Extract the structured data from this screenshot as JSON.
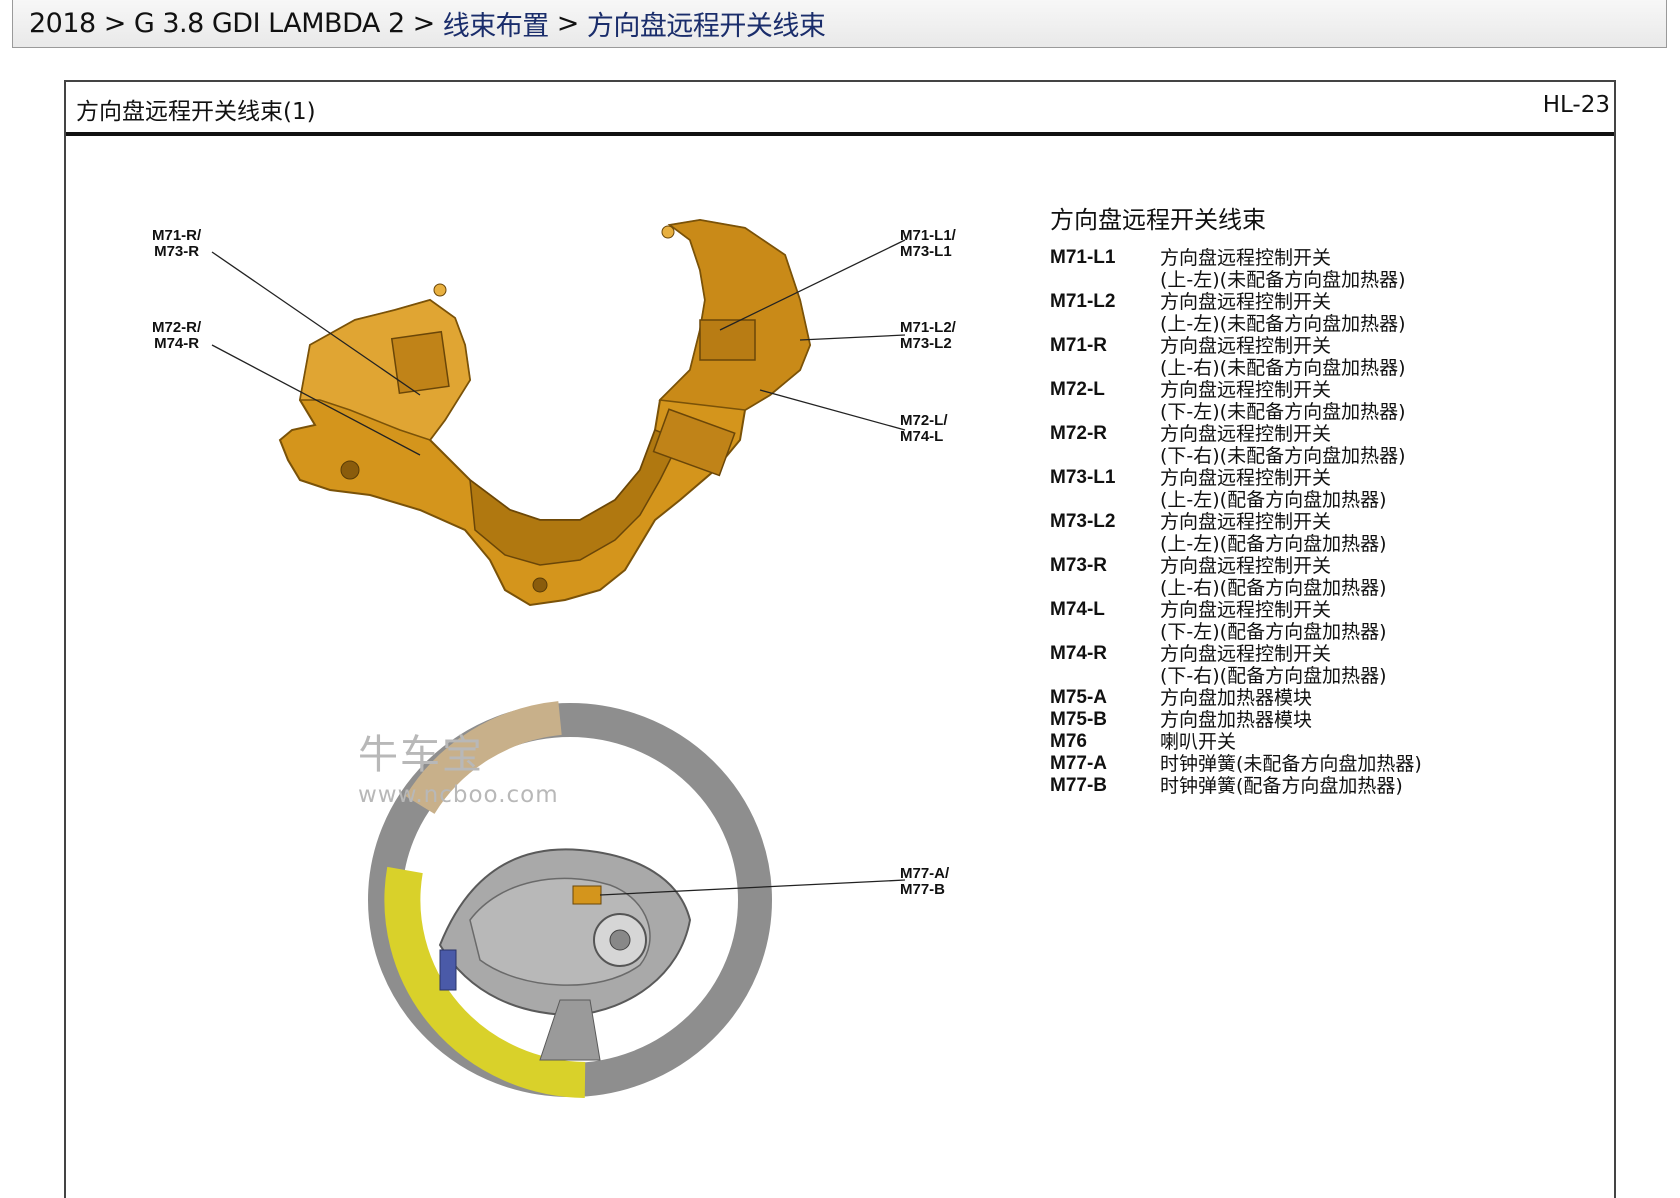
{
  "breadcrumb": {
    "items": [
      "2018",
      "G 3.8 GDI LAMBDA 2",
      "线束布置",
      "方向盘远程开关线束"
    ],
    "separator": ">"
  },
  "sheet": {
    "title": "方向盘远程开关线束(1)",
    "code": "HL-23"
  },
  "callouts": {
    "m71r_m73r": [
      "M71-R/",
      "M73-R"
    ],
    "m72r_m74r": [
      "M72-R/",
      "M74-R"
    ],
    "m71l1_m73l1": [
      "M71-L1/",
      "M73-L1"
    ],
    "m71l2_m73l2": [
      "M71-L2/",
      "M73-L2"
    ],
    "m72l_m74l": [
      "M72-L/",
      "M74-L"
    ],
    "m77a_m77b": [
      "M77-A/",
      "M77-B"
    ]
  },
  "legend": {
    "title": "方向盘远程开关线束",
    "entries": [
      {
        "code": "M71-L1",
        "lines": [
          "方向盘远程控制开关",
          "(上-左)(未配备方向盘加热器)"
        ]
      },
      {
        "code": "M71-L2",
        "lines": [
          "方向盘远程控制开关",
          "(上-左)(未配备方向盘加热器)"
        ]
      },
      {
        "code": "M71-R",
        "lines": [
          "方向盘远程控制开关",
          "(上-右)(未配备方向盘加热器)"
        ]
      },
      {
        "code": "M72-L",
        "lines": [
          "方向盘远程控制开关",
          "(下-左)(未配备方向盘加热器)"
        ]
      },
      {
        "code": "M72-R",
        "lines": [
          "方向盘远程控制开关",
          "(下-右)(未配备方向盘加热器)"
        ]
      },
      {
        "code": "M73-L1",
        "lines": [
          "方向盘远程控制开关",
          "(上-左)(配备方向盘加热器)"
        ]
      },
      {
        "code": "M73-L2",
        "lines": [
          "方向盘远程控制开关",
          "(上-左)(配备方向盘加热器)"
        ]
      },
      {
        "code": "M73-R",
        "lines": [
          "方向盘远程控制开关",
          "(上-右)(配备方向盘加热器)"
        ]
      },
      {
        "code": "M74-L",
        "lines": [
          "方向盘远程控制开关",
          "(下-左)(配备方向盘加热器)"
        ]
      },
      {
        "code": "M74-R",
        "lines": [
          "方向盘远程控制开关",
          "(下-右)(配备方向盘加热器)"
        ]
      },
      {
        "code": "M75-A",
        "lines": [
          "方向盘加热器模块"
        ]
      },
      {
        "code": "M75-B",
        "lines": [
          "方向盘加热器模块"
        ]
      },
      {
        "code": "M76",
        "lines": [
          "喇叭开关"
        ]
      },
      {
        "code": "M77-A",
        "lines": [
          "时钟弹簧(未配备方向盘加热器)"
        ]
      },
      {
        "code": "M77-B",
        "lines": [
          "时钟弹簧(配备方向盘加热器)"
        ]
      }
    ]
  },
  "watermark": {
    "name": "牛车宝",
    "url": "www.ncboo.com"
  },
  "colors": {
    "harness": "#d4951c",
    "harness_shadow": "#9c6a10",
    "wheel_grey": "#9a9a9a",
    "wheel_tan": "#c8b08a",
    "wheel_yellow": "#d9d12a"
  }
}
